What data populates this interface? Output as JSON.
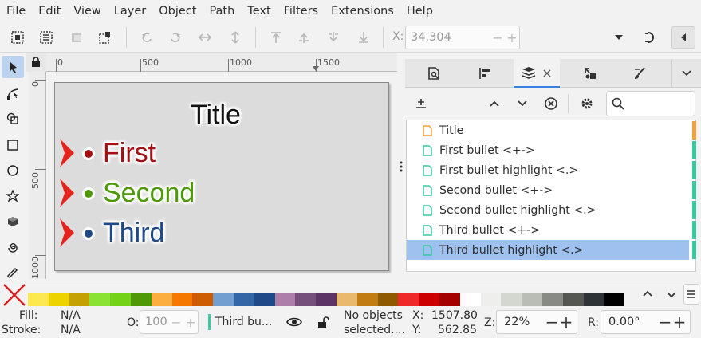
{
  "menu": [
    "File",
    "Edit",
    "View",
    "Layer",
    "Object",
    "Path",
    "Text",
    "Filters",
    "Extensions",
    "Help"
  ],
  "command_bar": {
    "x_label": "X:",
    "x_value": "34.304",
    "minus": "−",
    "plus": "+"
  },
  "ruler": {
    "h_labels": [
      "0",
      "500",
      "1000",
      "1500"
    ],
    "v_labels": [
      "0",
      "500",
      "1000"
    ]
  },
  "slide": {
    "title": "Title",
    "bullets": [
      {
        "text": "First",
        "color": "#a50f11"
      },
      {
        "text": "Second",
        "color": "#4e9a06"
      },
      {
        "text": "Third",
        "color": "#204a87"
      }
    ],
    "chevron_color": "#e3231c"
  },
  "objects_panel": {
    "close_glyph": "×",
    "items": [
      {
        "label": "Title",
        "icon_color": "#f0a040",
        "stripe": "#f0a040",
        "selected": false
      },
      {
        "label": "First bullet <+->",
        "icon_color": "#3cc8a0",
        "stripe": "#3cc8a0",
        "selected": false
      },
      {
        "label": "First bullet highlight <.>",
        "icon_color": "#3cc8a0",
        "stripe": "#3cc8a0",
        "selected": false
      },
      {
        "label": "Second bullet <+->",
        "icon_color": "#3cc8a0",
        "stripe": "#3cc8a0",
        "selected": false
      },
      {
        "label": "Second bullet highlight <.>",
        "icon_color": "#3cc8a0",
        "stripe": "#3cc8a0",
        "selected": false
      },
      {
        "label": "Third bullet <+->",
        "icon_color": "#3cc8a0",
        "stripe": "#3cc8a0",
        "selected": false
      },
      {
        "label": "Third bullet highlight <.>",
        "icon_color": "#3cc8a0",
        "stripe": "#3cc8a0",
        "selected": true
      }
    ]
  },
  "palette": [
    "#fce94f",
    "#edd400",
    "#c4a000",
    "#8ae234",
    "#73d216",
    "#4e9a06",
    "#fcaf3e",
    "#f57900",
    "#ce5c00",
    "#729fcf",
    "#3465a4",
    "#204a87",
    "#ad7fa8",
    "#75507b",
    "#5c3566",
    "#e9b96e",
    "#c17d11",
    "#8f5902",
    "#ef2929",
    "#cc0000",
    "#a40000",
    "#ffffff",
    "#eeeeec",
    "#d3d7cf",
    "#babdb6",
    "#888a85",
    "#555753",
    "#2e3436",
    "#000000"
  ],
  "status": {
    "fill_label": "Fill:",
    "fill_value": "N/A",
    "stroke_label": "Stroke:",
    "stroke_value": "N/A",
    "opacity_label": "O:",
    "opacity_value": "100",
    "layer": "Third bu...",
    "message_line1": "No objects",
    "message_line2": "selected....",
    "x_label": "X:",
    "x_value": "1507.80",
    "y_label": "Y:",
    "y_value": "562.85",
    "zoom_label": "Z:",
    "zoom_value": "22%",
    "rotate_label": "R:",
    "rotate_value": "0.00°"
  }
}
